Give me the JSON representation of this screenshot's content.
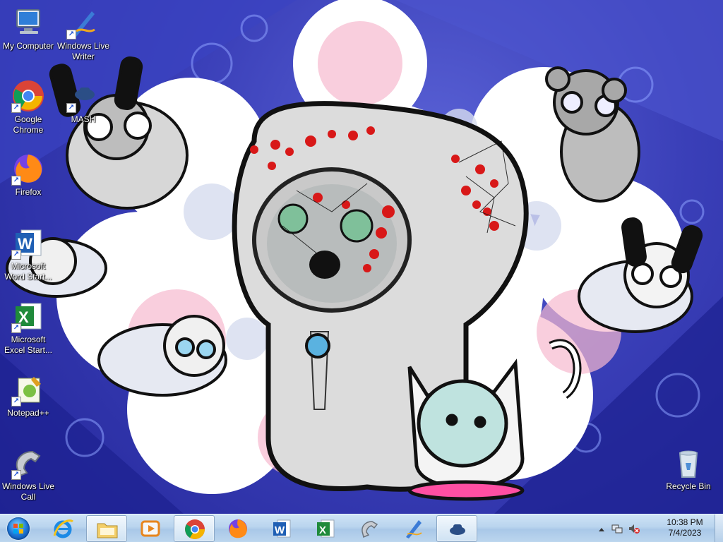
{
  "desktop": {
    "icons": [
      {
        "name": "my-computer",
        "label": "My Computer"
      },
      {
        "name": "windows-live-writer",
        "label": "Windows Live Writer"
      },
      {
        "name": "google-chrome",
        "label": "Google Chrome"
      },
      {
        "name": "mash",
        "label": "MASH"
      },
      {
        "name": "firefox",
        "label": "Firefox"
      },
      {
        "name": "word-starter",
        "label": "Microsoft Word Start..."
      },
      {
        "name": "excel-starter",
        "label": "Microsoft Excel Start..."
      },
      {
        "name": "notepad-plus-plus",
        "label": "Notepad++"
      },
      {
        "name": "windows-live-call",
        "label": "Windows Live Call"
      },
      {
        "name": "recycle-bin",
        "label": "Recycle Bin"
      }
    ]
  },
  "taskbar": {
    "pinned": [
      {
        "name": "internet-explorer",
        "icon": "ie-icon"
      },
      {
        "name": "windows-explorer",
        "icon": "folder-icon",
        "active": true
      },
      {
        "name": "media-player",
        "icon": "play-icon"
      },
      {
        "name": "chrome",
        "icon": "chrome-icon",
        "active": true
      },
      {
        "name": "firefox",
        "icon": "firefox-icon"
      },
      {
        "name": "word",
        "icon": "word-icon"
      },
      {
        "name": "excel",
        "icon": "excel-icon"
      },
      {
        "name": "live-call",
        "icon": "phone-icon"
      },
      {
        "name": "live-writer",
        "icon": "pen-icon"
      },
      {
        "name": "mash",
        "icon": "mash-icon",
        "active": true
      }
    ],
    "clock": {
      "time": "10:38 PM",
      "date": "7/4/2023"
    }
  },
  "colors": {
    "taskbar": "#b9d4ee",
    "wallpaper_base": "#2b2f9a",
    "accent_red": "#d81818"
  }
}
